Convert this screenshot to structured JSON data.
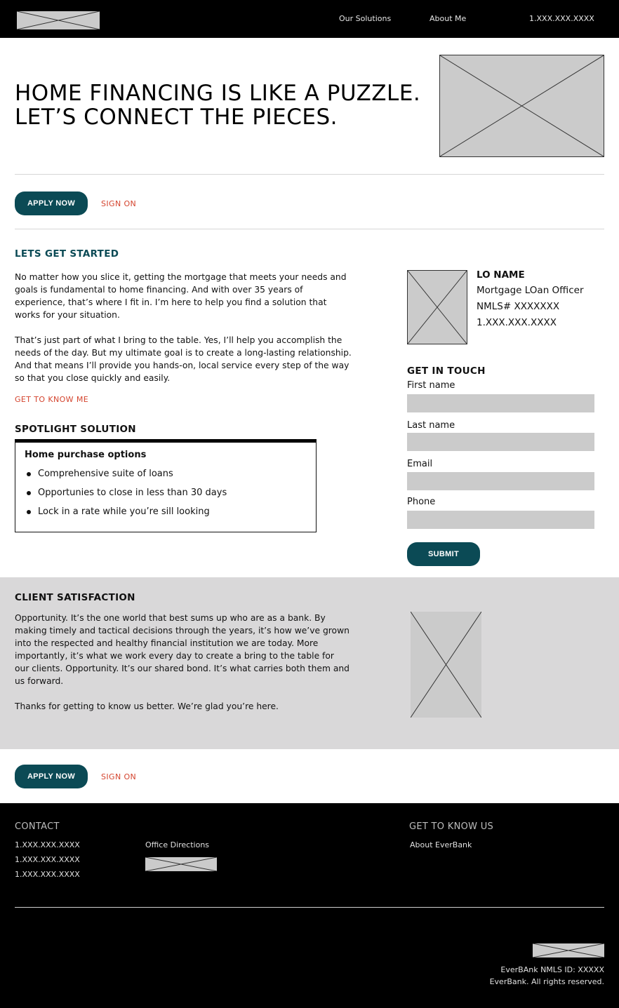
{
  "header": {
    "nav": [
      "Our Solutions",
      "About Me"
    ],
    "phone": "1.XXX.XXX.XXXX"
  },
  "hero": {
    "title_line1": "HOME FINANCING IS LIKE A PUZZLE.",
    "title_line2": "LET’S CONNECT THE PIECES."
  },
  "cta": {
    "apply_label": "APPLY NOW",
    "signon_label": "SIGN ON"
  },
  "intro": {
    "heading": "LETS GET STARTED",
    "para1": "No matter how you slice it, getting the mortgage that meets your needs and\ngoals is fundamental to home financing. And with over 35 years of\nexperience, that’s where I fit in. I’m here to help you find a solution that\nworks for your situation.",
    "para2": "That’s just part of what I bring to the table. Yes, I’ll help you accomplish the\nneeds of the day. But my ultimate goal is to create a long-lasting relationship.\nAnd that means I’ll provide you hands-on, local service every step of the way\nso that you close quickly and easily.",
    "link": "GET TO KNOW ME"
  },
  "spotlight": {
    "heading": "SPOTLIGHT SOLUTION",
    "box_title": "Home purchase options",
    "items": [
      "Comprehensive suite of loans",
      "Opportunies to close in less than 30 days",
      "Lock in a rate while you’re sill looking"
    ]
  },
  "officer": {
    "name": "LO NAME",
    "title": "Mortgage LOan Officer",
    "nmls": "NMLS# XXXXXXX",
    "phone": "1.XXX.XXX.XXXX"
  },
  "contact_form": {
    "heading": "GET IN TOUCH",
    "fields": [
      {
        "label": "First name",
        "value": ""
      },
      {
        "label": "Last name",
        "value": ""
      },
      {
        "label": "Email",
        "value": ""
      },
      {
        "label": "Phone",
        "value": ""
      }
    ],
    "submit_label": "SUBMIT"
  },
  "client": {
    "heading": "CLIENT SATISFACTION",
    "para1": "Opportunity. It’s the one world that best sums up who are as a bank. By\nmaking timely and tactical decisions through the years, it’s how we’ve grown\ninto the respected and healthy financial institution we are today. More\nimportantly, it’s what we work every day to create a bring to the table for\nour clients. Opportunity. It’s our shared bond. It’s what carries both them and\nus forward.",
    "para2": "Thanks for getting to know us better. We’re glad  you’re here."
  },
  "footer": {
    "contact_heading": "CONTACT",
    "phones": [
      "1.XXX.XXX.XXXX",
      "1.XXX.XXX.XXXX",
      "1.XXX.XXX.XXXX"
    ],
    "directions_label": "Office Directions",
    "know_heading": "GET TO KNOW US",
    "about_link": "About EverBank",
    "nmls": "EverBAnk NMLS ID: XXXXX",
    "rights": "EverBank. All rights reserved."
  },
  "colors": {
    "brand_teal": "#0b4a55",
    "link_red": "#d4442e",
    "header_bg": "#000000",
    "placeholder_gray": "#cbcbcb",
    "band_gray": "#d9d8d9"
  }
}
